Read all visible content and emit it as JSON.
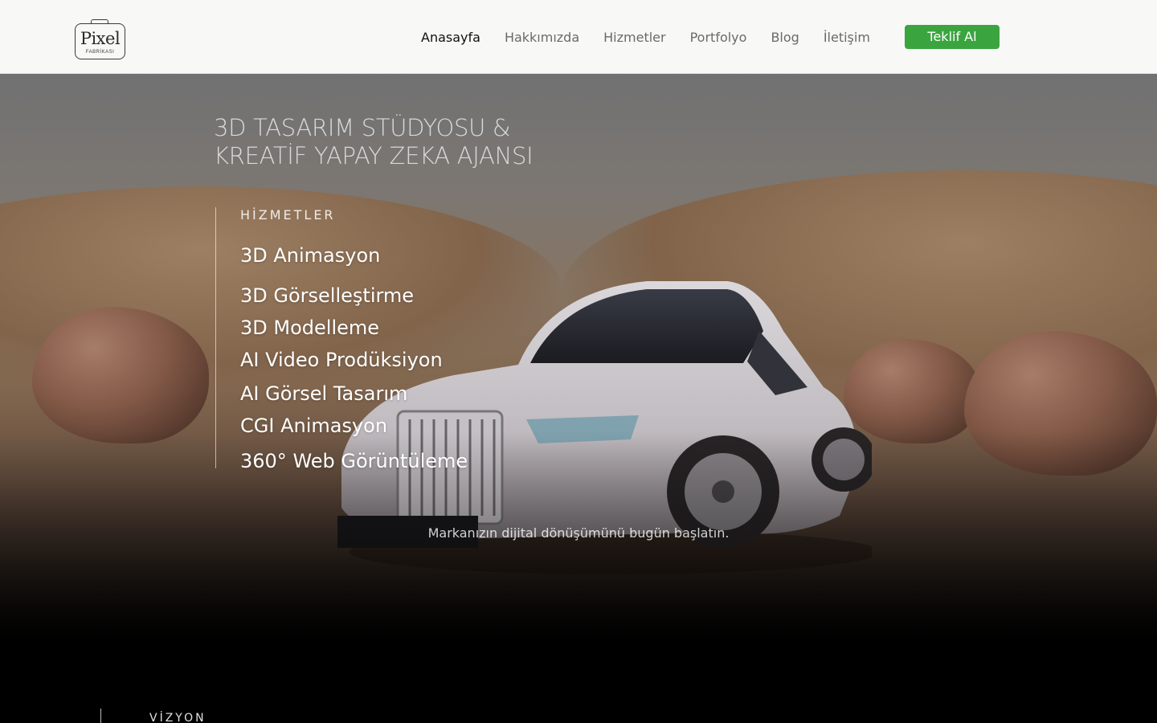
{
  "logo": {
    "word": "Pixel",
    "sub": "FABRİKASI"
  },
  "nav": {
    "items": [
      {
        "label": "Anasayfa",
        "active": true
      },
      {
        "label": "Hakkımızda",
        "active": false
      },
      {
        "label": "Hizmetler",
        "active": false
      },
      {
        "label": "Portfolyo",
        "active": false
      },
      {
        "label": "Blog",
        "active": false
      },
      {
        "label": "İletişim",
        "active": false
      }
    ],
    "cta_label": "Teklif Al"
  },
  "colors": {
    "accent": "#3aa53f",
    "header_bg": "#f8f8f7"
  },
  "hero": {
    "title_line1": "3D TASARIM STÜDYOSU &",
    "title_line2": "KREATİF YAPAY ZEKA AJANSI",
    "services_label": "HİZMETLER",
    "services": [
      "3D Animasyon",
      "3D Görselleştirme",
      "3D Modelleme",
      "AI Video Prodüksiyon",
      "AI Görsel Tasarım",
      "CGI Animasyon",
      "360° Web Görüntüleme"
    ],
    "tagline": "Markanızın dijital dönüşümünü bugün başlatın."
  },
  "vision": {
    "label": "VİZYON"
  }
}
